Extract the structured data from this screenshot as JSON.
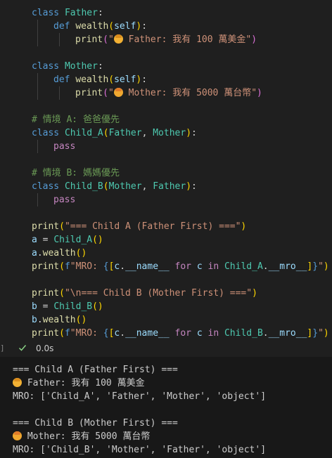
{
  "code": {
    "l1": {
      "kw": "class",
      "name": "Father",
      "colon": ":"
    },
    "l2": {
      "kw": "def",
      "fn": "wealth",
      "self": "self",
      "end": "):"
    },
    "l3": {
      "fn": "print",
      "str_open": "\"",
      "str_text": " Father: 我有 100 萬美金\"",
      "emoji": "older-man-emoji"
    },
    "l5": {
      "kw": "class",
      "name": "Mother",
      "colon": ":"
    },
    "l6": {
      "kw": "def",
      "fn": "wealth",
      "self": "self",
      "end": "):"
    },
    "l7": {
      "fn": "print",
      "str_open": "\"",
      "str_text": " Mother: 我有 5000 萬台幣\"",
      "emoji": "older-woman-emoji"
    },
    "l9": "# 情境 A: 爸爸優先",
    "l10": {
      "kw": "class",
      "name": "Child_A",
      "p1": "Father",
      "p2": "Mother",
      "end": "):"
    },
    "l11": "pass",
    "l13": "# 情境 B: 媽媽優先",
    "l14": {
      "kw": "class",
      "name": "Child_B",
      "p1": "Mother",
      "p2": "Father",
      "end": "):"
    },
    "l15": "pass",
    "l17": {
      "fn": "print",
      "str": "\"=== Child A (Father First) ===\""
    },
    "l18": {
      "var": "a",
      "eq": " = ",
      "cls": "Child_A",
      "call": "()"
    },
    "l19": {
      "var": "a",
      "dot": ".",
      "fn": "wealth",
      "call": "()"
    },
    "l20": {
      "fn": "print",
      "fpre": "f",
      "s1": "\"MRO: ",
      "inner1": "[c.",
      "attr": "__name__",
      "for": "for",
      "c": "c",
      "in": "in",
      "cls": "Child_A",
      "mro": "__mro__",
      "s2": "\""
    },
    "l22": {
      "fn": "print",
      "str": "\"\\n=== Child B (Mother First) ===\""
    },
    "l23": {
      "var": "b",
      "eq": " = ",
      "cls": "Child_B",
      "call": "()"
    },
    "l24": {
      "var": "b",
      "dot": ".",
      "fn": "wealth",
      "call": "()"
    },
    "l25": {
      "fn": "print",
      "fpre": "f",
      "s1": "\"MRO: ",
      "inner1": "[c.",
      "attr": "__name__",
      "for": "for",
      "c": "c",
      "in": "in",
      "cls": "Child_B",
      "mro": "__mro__",
      "s2": "\""
    }
  },
  "status": {
    "bracket": "]",
    "time": "0.0s",
    "icon": "check-icon",
    "color": "#89d185"
  },
  "output": {
    "o1": "=== Child A (Father First) ===",
    "o2": " Father: 我有 100 萬美金",
    "o3": "MRO: ['Child_A', 'Father', 'Mother', 'object']",
    "o5": "=== Child B (Mother First) ===",
    "o6": " Mother: 我有 5000 萬台幣",
    "o7": "MRO: ['Child_B', 'Mother', 'Father', 'object']"
  }
}
